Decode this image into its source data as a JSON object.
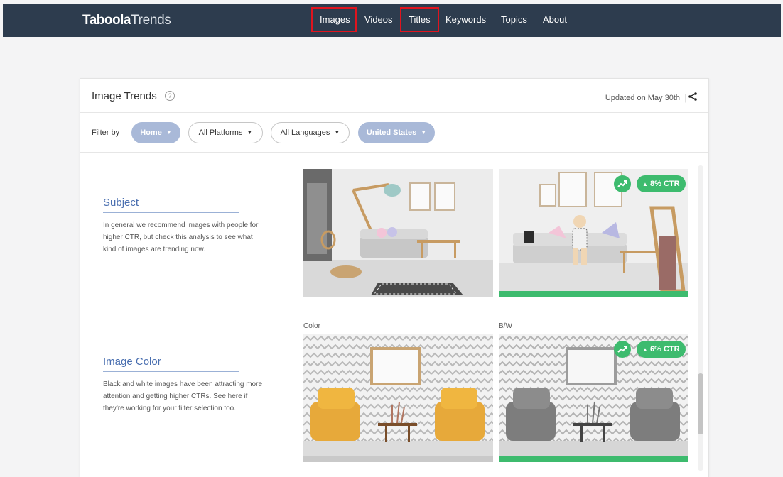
{
  "header": {
    "logo_bold": "Taboola",
    "logo_light": "Trends",
    "nav": [
      "Images",
      "Videos",
      "Titles",
      "Keywords",
      "Topics",
      "About"
    ],
    "highlighted": [
      "Images",
      "Titles"
    ],
    "highlight_color": "#e0141e",
    "bg_color": "#2d3c4e"
  },
  "card": {
    "title": "Image Trends",
    "help_icon": "question-circle-icon",
    "updated": "Updated on May 30th",
    "separator": "|",
    "share_icon": "share-icon"
  },
  "filters": {
    "label": "Filter by",
    "pills": [
      {
        "label": "Home",
        "active": true
      },
      {
        "label": "All Platforms",
        "active": false
      },
      {
        "label": "All Languages",
        "active": false
      },
      {
        "label": "United States",
        "active": true
      }
    ],
    "active_color": "#a9b9d8"
  },
  "sections": [
    {
      "title": "Subject",
      "desc": "In general we recommend images with people for higher CTR, but check this analysis to see what kind of images are trending now.",
      "tiles": [
        {
          "kind": "room-empty",
          "winner": false
        },
        {
          "kind": "room-with-child",
          "winner": true,
          "ctr": "8% CTR"
        }
      ]
    },
    {
      "title": "Image Color",
      "desc": "Black and white images have been attracting more attention and getting higher CTRs. See here if they're working for your filter selection too.",
      "col_labels": [
        "Color",
        "B/W"
      ],
      "tiles": [
        {
          "kind": "chairs-color",
          "winner": false
        },
        {
          "kind": "chairs-bw",
          "winner": true,
          "ctr": "6% CTR"
        }
      ]
    }
  ],
  "colors": {
    "accent_green": "#3dbb6e",
    "section_blue": "#4a6fb0"
  }
}
